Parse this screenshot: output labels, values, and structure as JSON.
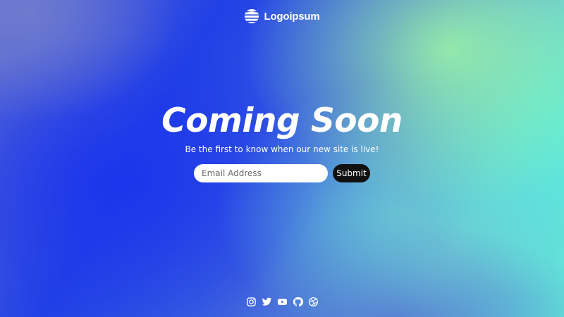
{
  "brand": {
    "name": "Logoipsum",
    "logo_icon": "striped-globe-icon"
  },
  "hero": {
    "title": "Coming Soon",
    "subtitle": "Be the first to know when our new site is live!"
  },
  "signup": {
    "email_placeholder": "Email Address",
    "email_value": "",
    "submit_label": "Submit"
  },
  "social": {
    "icons": [
      "instagram-icon",
      "twitter-icon",
      "youtube-icon",
      "github-icon",
      "dribbble-icon"
    ]
  },
  "colors": {
    "text": "#ffffff",
    "button_bg": "#111111",
    "input_bg": "#ffffff",
    "gradient_blue": "#1c34ec",
    "gradient_mint": "#58ecde",
    "gradient_green": "#96eca8"
  }
}
